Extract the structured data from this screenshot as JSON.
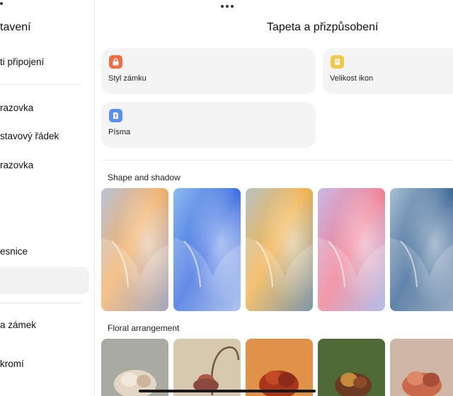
{
  "sidebar": {
    "title": "tavení",
    "items": [
      {
        "label": "ti připojení"
      },
      {
        "label": "razovka"
      },
      {
        "label": "stavový řádek"
      },
      {
        "label": "razovka"
      },
      {
        "label": "esnice"
      },
      {
        "label": ""
      },
      {
        "label": "a zámek"
      },
      {
        "label": "kromí"
      }
    ]
  },
  "header": {
    "title": "Tapeta a přizpůsobení"
  },
  "cards": [
    {
      "label": "Styl zámku",
      "icon": "lock-style-icon",
      "color": "#ee6d45"
    },
    {
      "label": "Velikost ikon",
      "icon": "icon-size-icon",
      "color": "#f2c84b"
    },
    {
      "label": "Písma",
      "icon": "fonts-icon",
      "color": "#5a8ff0"
    }
  ],
  "sections": {
    "shape": {
      "title": "Shape and shadow"
    },
    "floral": {
      "title": "Floral arrangement"
    }
  },
  "colors": {
    "accent_orange": "#ee6d45",
    "accent_yellow": "#f2c84b",
    "accent_blue": "#5a8ff0"
  }
}
